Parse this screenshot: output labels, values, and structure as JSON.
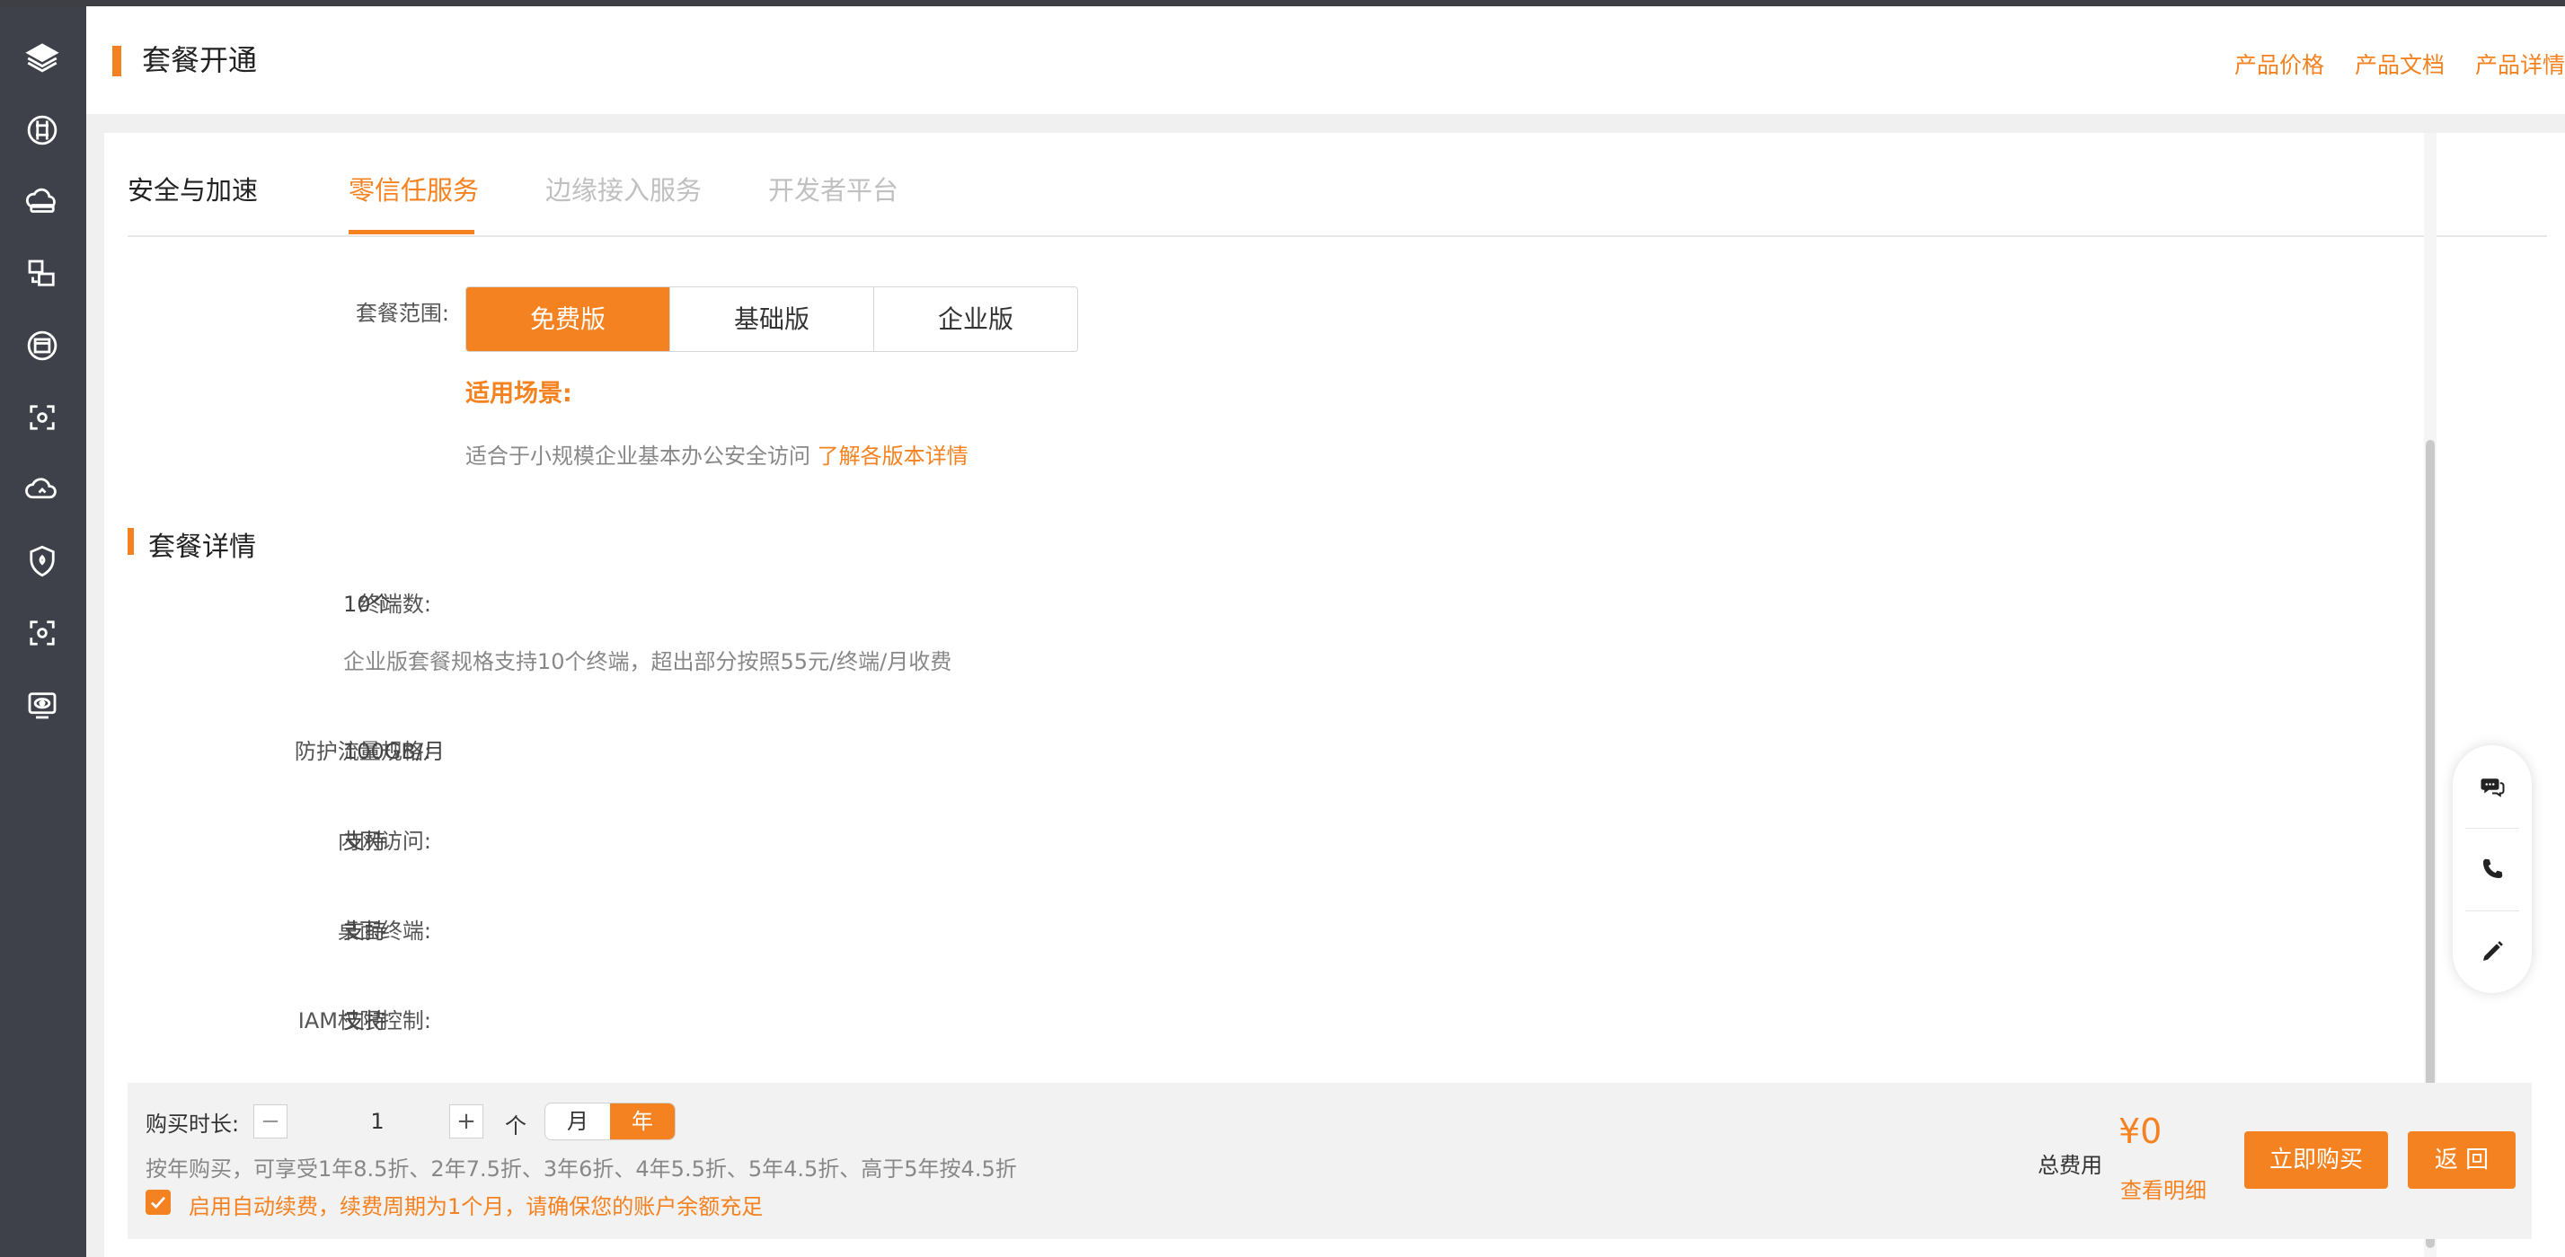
{
  "header": {
    "title": "套餐开通",
    "links": [
      "产品价格",
      "产品文档",
      "产品详情"
    ]
  },
  "sidebar": {
    "icons": [
      "layers-icon",
      "network-icon",
      "cloud-drive-icon",
      "transfer-icon",
      "window-icon",
      "scan-icon",
      "cloud-sync-icon",
      "shield-icon",
      "scan-icon",
      "monitor-eye-icon"
    ]
  },
  "tabs": [
    {
      "label": "安全与加速"
    },
    {
      "label": "零信任服务"
    },
    {
      "label": "边缘接入服务"
    },
    {
      "label": "开发者平台"
    }
  ],
  "plan": {
    "range_label": "套餐范围:",
    "options": [
      "免费版",
      "基础版",
      "企业版"
    ],
    "selected": "免费版",
    "scene_title": "适用场景:",
    "scene_desc": "适合于小规模企业基本办公安全访问",
    "scene_link": "了解各版本详情"
  },
  "details": {
    "title": "套餐详情",
    "rows": [
      {
        "label": "终端数:",
        "value": "10个",
        "note": "企业版套餐规格支持10个终端，超出部分按照55元/终端/月收费"
      },
      {
        "label": "防护流量规格:",
        "value": "100GB/月"
      },
      {
        "label": "内网访问:",
        "value": "支持"
      },
      {
        "label": "桌面终端:",
        "value": "支持"
      },
      {
        "label": "IAM权限控制:",
        "value": "支持"
      }
    ]
  },
  "purchase": {
    "duration_label": "购买时长:",
    "minus": "−",
    "plus": "+",
    "quantity": "1",
    "unit": "个",
    "periods": [
      "月",
      "年"
    ],
    "selected_period": "年",
    "discount_note": "按年购买，可享受1年8.5折、2年7.5折、3年6折、4年5.5折、5年4.5折、高于5年按4.5折",
    "auto_renew_checked": true,
    "auto_renew_text": "启用自动续费，续费周期为1个月，请确保您的账户余额充足",
    "total_label": "总费用",
    "price": "¥0",
    "detail_link": "查看明细",
    "buy_button": "立即购买",
    "back_button": "返 回"
  },
  "colors": {
    "accent": "#f58220",
    "sidebar": "#3e4149"
  }
}
